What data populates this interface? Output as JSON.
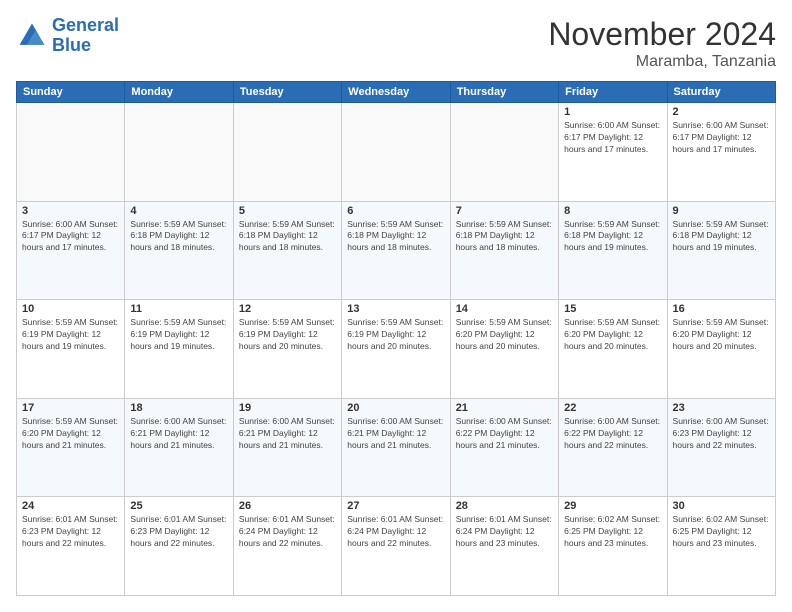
{
  "header": {
    "logo_line1": "General",
    "logo_line2": "Blue",
    "month_title": "November 2024",
    "location": "Maramba, Tanzania"
  },
  "weekdays": [
    "Sunday",
    "Monday",
    "Tuesday",
    "Wednesday",
    "Thursday",
    "Friday",
    "Saturday"
  ],
  "weeks": [
    [
      {
        "day": "",
        "info": ""
      },
      {
        "day": "",
        "info": ""
      },
      {
        "day": "",
        "info": ""
      },
      {
        "day": "",
        "info": ""
      },
      {
        "day": "",
        "info": ""
      },
      {
        "day": "1",
        "info": "Sunrise: 6:00 AM\nSunset: 6:17 PM\nDaylight: 12 hours and 17 minutes."
      },
      {
        "day": "2",
        "info": "Sunrise: 6:00 AM\nSunset: 6:17 PM\nDaylight: 12 hours and 17 minutes."
      }
    ],
    [
      {
        "day": "3",
        "info": "Sunrise: 6:00 AM\nSunset: 6:17 PM\nDaylight: 12 hours and 17 minutes."
      },
      {
        "day": "4",
        "info": "Sunrise: 5:59 AM\nSunset: 6:18 PM\nDaylight: 12 hours and 18 minutes."
      },
      {
        "day": "5",
        "info": "Sunrise: 5:59 AM\nSunset: 6:18 PM\nDaylight: 12 hours and 18 minutes."
      },
      {
        "day": "6",
        "info": "Sunrise: 5:59 AM\nSunset: 6:18 PM\nDaylight: 12 hours and 18 minutes."
      },
      {
        "day": "7",
        "info": "Sunrise: 5:59 AM\nSunset: 6:18 PM\nDaylight: 12 hours and 18 minutes."
      },
      {
        "day": "8",
        "info": "Sunrise: 5:59 AM\nSunset: 6:18 PM\nDaylight: 12 hours and 19 minutes."
      },
      {
        "day": "9",
        "info": "Sunrise: 5:59 AM\nSunset: 6:18 PM\nDaylight: 12 hours and 19 minutes."
      }
    ],
    [
      {
        "day": "10",
        "info": "Sunrise: 5:59 AM\nSunset: 6:19 PM\nDaylight: 12 hours and 19 minutes."
      },
      {
        "day": "11",
        "info": "Sunrise: 5:59 AM\nSunset: 6:19 PM\nDaylight: 12 hours and 19 minutes."
      },
      {
        "day": "12",
        "info": "Sunrise: 5:59 AM\nSunset: 6:19 PM\nDaylight: 12 hours and 20 minutes."
      },
      {
        "day": "13",
        "info": "Sunrise: 5:59 AM\nSunset: 6:19 PM\nDaylight: 12 hours and 20 minutes."
      },
      {
        "day": "14",
        "info": "Sunrise: 5:59 AM\nSunset: 6:20 PM\nDaylight: 12 hours and 20 minutes."
      },
      {
        "day": "15",
        "info": "Sunrise: 5:59 AM\nSunset: 6:20 PM\nDaylight: 12 hours and 20 minutes."
      },
      {
        "day": "16",
        "info": "Sunrise: 5:59 AM\nSunset: 6:20 PM\nDaylight: 12 hours and 20 minutes."
      }
    ],
    [
      {
        "day": "17",
        "info": "Sunrise: 5:59 AM\nSunset: 6:20 PM\nDaylight: 12 hours and 21 minutes."
      },
      {
        "day": "18",
        "info": "Sunrise: 6:00 AM\nSunset: 6:21 PM\nDaylight: 12 hours and 21 minutes."
      },
      {
        "day": "19",
        "info": "Sunrise: 6:00 AM\nSunset: 6:21 PM\nDaylight: 12 hours and 21 minutes."
      },
      {
        "day": "20",
        "info": "Sunrise: 6:00 AM\nSunset: 6:21 PM\nDaylight: 12 hours and 21 minutes."
      },
      {
        "day": "21",
        "info": "Sunrise: 6:00 AM\nSunset: 6:22 PM\nDaylight: 12 hours and 21 minutes."
      },
      {
        "day": "22",
        "info": "Sunrise: 6:00 AM\nSunset: 6:22 PM\nDaylight: 12 hours and 22 minutes."
      },
      {
        "day": "23",
        "info": "Sunrise: 6:00 AM\nSunset: 6:23 PM\nDaylight: 12 hours and 22 minutes."
      }
    ],
    [
      {
        "day": "24",
        "info": "Sunrise: 6:01 AM\nSunset: 6:23 PM\nDaylight: 12 hours and 22 minutes."
      },
      {
        "day": "25",
        "info": "Sunrise: 6:01 AM\nSunset: 6:23 PM\nDaylight: 12 hours and 22 minutes."
      },
      {
        "day": "26",
        "info": "Sunrise: 6:01 AM\nSunset: 6:24 PM\nDaylight: 12 hours and 22 minutes."
      },
      {
        "day": "27",
        "info": "Sunrise: 6:01 AM\nSunset: 6:24 PM\nDaylight: 12 hours and 22 minutes."
      },
      {
        "day": "28",
        "info": "Sunrise: 6:01 AM\nSunset: 6:24 PM\nDaylight: 12 hours and 23 minutes."
      },
      {
        "day": "29",
        "info": "Sunrise: 6:02 AM\nSunset: 6:25 PM\nDaylight: 12 hours and 23 minutes."
      },
      {
        "day": "30",
        "info": "Sunrise: 6:02 AM\nSunset: 6:25 PM\nDaylight: 12 hours and 23 minutes."
      }
    ]
  ]
}
